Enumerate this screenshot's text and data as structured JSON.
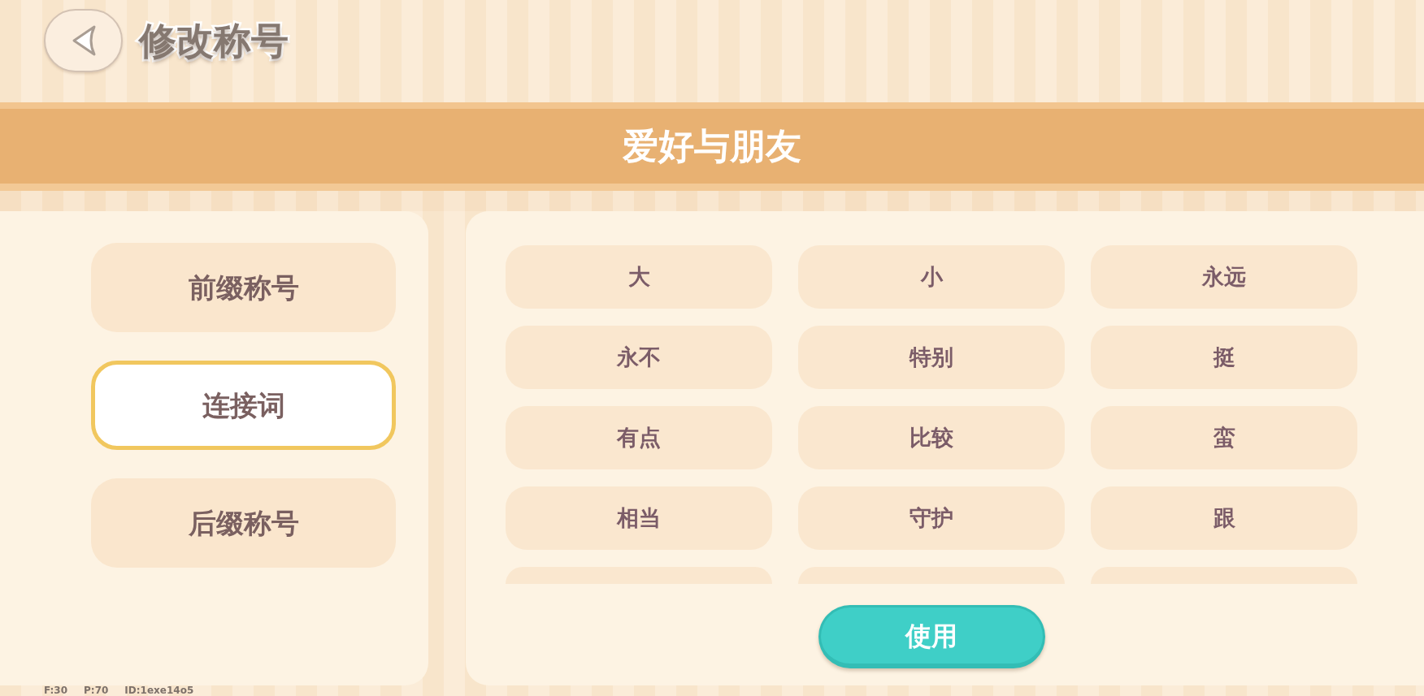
{
  "top_bar": {
    "title": "修改称号"
  },
  "banner": {
    "title": "爱好与朋友"
  },
  "categories": [
    {
      "label": "前缀称号",
      "selected": false
    },
    {
      "label": "连接词",
      "selected": true
    },
    {
      "label": "后缀称号",
      "selected": false
    }
  ],
  "options": [
    {
      "label": "大",
      "selected": false
    },
    {
      "label": "小",
      "selected": false
    },
    {
      "label": "永远",
      "selected": false
    },
    {
      "label": "永不",
      "selected": false
    },
    {
      "label": "特别",
      "selected": false
    },
    {
      "label": "挺",
      "selected": false
    },
    {
      "label": "有点",
      "selected": false
    },
    {
      "label": "比较",
      "selected": false
    },
    {
      "label": "蛮",
      "selected": false
    },
    {
      "label": "相当",
      "selected": false
    },
    {
      "label": "守护",
      "selected": false
    },
    {
      "label": "跟",
      "selected": false
    }
  ],
  "options_more_below": true,
  "use_button": {
    "label": "使用"
  },
  "debug_overlay": [
    "F:30",
    "P:70",
    "ID:1exe14o5"
  ]
}
